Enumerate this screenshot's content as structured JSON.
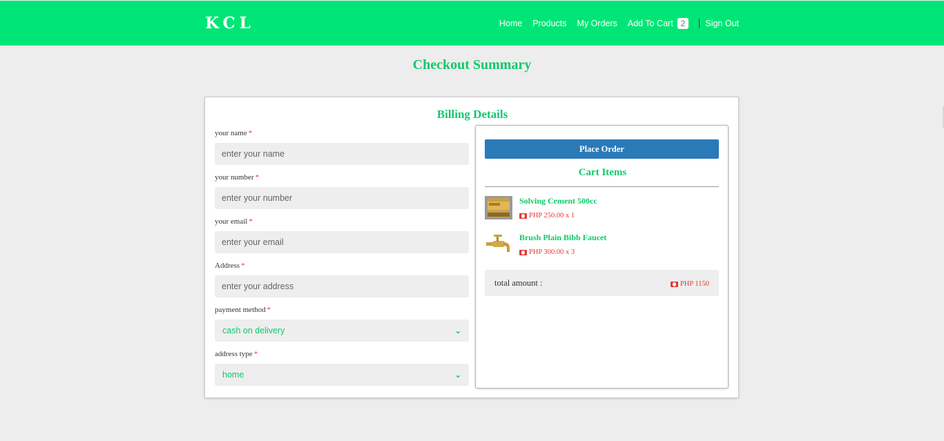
{
  "brand": {
    "logo": "KCL",
    "accent": "#00e676",
    "title_color": "#10c96a",
    "price_color": "#e53935",
    "button_color": "#2a7ab8"
  },
  "nav": {
    "home": "Home",
    "products": "Products",
    "orders": "My Orders",
    "cart": "Add To Cart",
    "cart_count": "2",
    "signout": "Sign Out"
  },
  "page_title": "Checkout Summary",
  "billing": {
    "title": "Billing Details",
    "name_label": "your name",
    "name_placeholder": "enter your name",
    "number_label": "your number",
    "number_placeholder": "enter your number",
    "email_label": "your email",
    "email_placeholder": "enter your email",
    "address_label": "Address",
    "address_placeholder": "enter your address",
    "payment_label": "payment method",
    "payment_value": "cash on delivery",
    "address_type_label": "address type",
    "address_type_value": "home",
    "required_mark": "*"
  },
  "cart": {
    "place_order": "Place Order",
    "title": "Cart Items",
    "items": [
      {
        "name": "Solving Cement 500cc",
        "price": "PHP 250.00 x 1",
        "icon": "cement-can-icon"
      },
      {
        "name": "Brush Plain Bibb Faucet",
        "price": "PHP 300.00 x 3",
        "icon": "faucet-icon"
      }
    ],
    "total_label": "total amount :",
    "total_value": "PHP 1150"
  }
}
